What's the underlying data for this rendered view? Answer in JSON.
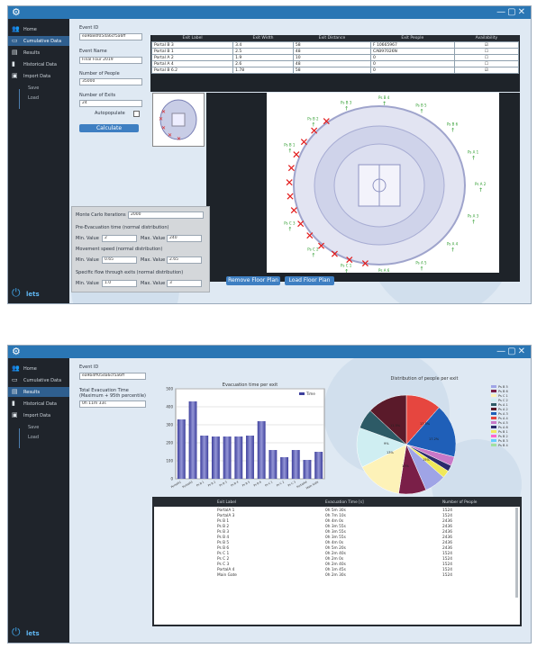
{
  "app": {
    "brand": "lets",
    "window_controls": "—▢✕"
  },
  "sidebar_top": [
    {
      "icon": "group-icon",
      "label": "Home",
      "glyph": "👥"
    },
    {
      "icon": "laptop-icon",
      "label": "Cumulative Data",
      "glyph": "▭",
      "active": true
    },
    {
      "icon": "doc-icon",
      "label": "Results",
      "glyph": "▤"
    },
    {
      "icon": "chart-icon",
      "label": "Historical Data",
      "glyph": "▮"
    },
    {
      "icon": "disk-icon",
      "label": "Import Data",
      "glyph": "▣"
    }
  ],
  "sidebar_top_sub": [
    "Save",
    "Load"
  ],
  "sidebar_bottom": [
    {
      "icon": "group-icon",
      "label": "Home",
      "glyph": "👥"
    },
    {
      "icon": "laptop-icon",
      "label": "Cumulative Data",
      "glyph": "▭"
    },
    {
      "icon": "doc-icon",
      "label": "Results",
      "glyph": "▤",
      "active": true
    },
    {
      "icon": "chart-icon",
      "label": "Historical Data",
      "glyph": "▮"
    },
    {
      "icon": "disk-icon",
      "label": "Import Data",
      "glyph": "▣"
    }
  ],
  "sidebar_bottom_sub": [
    "Save",
    "Load"
  ],
  "form": {
    "event_id_label": "Event ID",
    "event_id_value": "ea9b84f05da6cf5a6ff",
    "event_name_label": "Event Name",
    "event_name_value": "Final Four 2019",
    "people_label": "Number of People",
    "people_value": "35000",
    "exits_label": "Number of Exits",
    "exits_value": "24",
    "autopopulate_label": "Autopopulate",
    "calculate_label": "Calculate"
  },
  "exit_table": {
    "headers": [
      "Exit Label",
      "Exit Width",
      "Exit Distance",
      "Exit People",
      "Availability"
    ],
    "rows": [
      [
        "Portal B 3",
        "3.4",
        "58",
        "F 10665967",
        "☑"
      ],
      [
        "Portal B 1",
        "2.5",
        "48",
        "CAB97026N",
        "☐"
      ],
      [
        "Portal A 2",
        "1.9",
        "10",
        "0",
        "☐"
      ],
      [
        "Portal A 4",
        "2.6",
        "48",
        "0",
        "☐"
      ],
      [
        "Portal B 6.2",
        "1.78",
        "58",
        "0",
        "☑"
      ]
    ]
  },
  "params": {
    "iterations_label": "Monte Carlo Iterations",
    "iterations_value": "2000",
    "prep_label": "Pre-Evacuation time (normal distribution)",
    "prep_min_label": "Min. Value",
    "prep_min_value": "2",
    "prep_max_label": "Max. Value",
    "prep_max_value": "240",
    "speed_label": "Movement speed (normal distribution)",
    "speed_min_label": "Min. Value",
    "speed_min_value": "0.65",
    "speed_max_label": "Max. Value",
    "speed_max_value": "2.65",
    "flow_label": "Specific flow through exits (normal distribution)",
    "flow_min_label": "Min. Value",
    "flow_min_value": "1.0",
    "flow_max_label": "Max. Value",
    "flow_max_value": "3"
  },
  "buttons": {
    "remove_floor_plan": "Remove Floor Plan",
    "load_floor_plan": "Load Floor Plan"
  },
  "floor_plan_exit_labels": [
    "Ps B 1",
    "Ps B 2",
    "Ps B 3",
    "Ps B 4",
    "Ps B 5",
    "Ps B 6",
    "Ps A 1",
    "Ps A 2",
    "Ps A 3",
    "Ps A 4",
    "Ps A 5",
    "Ps A 6",
    "Ps C 1",
    "Ps C 2",
    "Ps C 3"
  ],
  "results": {
    "event_id_label": "Event ID",
    "event_id_value": "ea9b4ff05da6cf5a6ff",
    "total_time_label": "Total Evacuation Time",
    "total_time_sub": "(Maximum + 95th percentile)",
    "total_time_value": "0h 11m 33s"
  },
  "chart_data": [
    {
      "type": "bar",
      "title": "Evacuation time per exit",
      "legend": [
        "Time"
      ],
      "categories": [
        "PortalA1",
        "PortalA3",
        "Ps B 1",
        "Ps B 2",
        "Ps B 3",
        "Ps B 4",
        "Ps B 5",
        "Ps B 6",
        "Ps C 1",
        "Ps C 2",
        "Ps C 3",
        "PortalA4",
        "Main Gate"
      ],
      "values": [
        330,
        430,
        240,
        235,
        235,
        235,
        240,
        320,
        160,
        120,
        160,
        105,
        150
      ],
      "ylim": [
        0,
        500
      ],
      "yticks": [
        "0",
        "100",
        "200",
        "300",
        "400",
        "500"
      ],
      "colors": {
        "bar": "#3d3f9c",
        "bar_light": "#9496d6"
      }
    },
    {
      "type": "pie",
      "title": "Distribution of people per exit",
      "slices": [
        {
          "label": "PortalB 3",
          "value": 11.5,
          "color": "#e6463f"
        },
        {
          "label": "PortalB 1",
          "value": 17.5,
          "color": "#1f5fb8"
        },
        {
          "label": "Ps B 2",
          "value": 3.0,
          "color": "#c878c8"
        },
        {
          "label": "Ps B 1",
          "value": 2.0,
          "color": "#2b2b6c"
        },
        {
          "label": "Ps B 3",
          "value": 2.5,
          "color": "#f0e85a"
        },
        {
          "label": "Ps B 4",
          "value": 7.0,
          "color": "#9fa4e6"
        },
        {
          "label": "Ps B 5",
          "value": 9.0,
          "color": "#7a1f48"
        },
        {
          "label": "Ps B 6",
          "value": 15.0,
          "color": "#fdf2b8"
        },
        {
          "label": "Ps C 1",
          "value": 13.0,
          "color": "#cfeef2"
        },
        {
          "label": "Ps C 2",
          "value": 6.5,
          "color": "#2d5a66"
        },
        {
          "label": "PortalA 1",
          "value": 13.0,
          "color": "#5a1a2a"
        }
      ],
      "slice_labels": [
        "11.5%",
        "17.5%",
        "17.2%",
        "15%",
        "13%",
        "13%",
        "9%"
      ],
      "legend_items": [
        "Ps B 5",
        "Ps B 6",
        "Ps C 1",
        "Ps C 2",
        "Ps A 1",
        "Ps A 2",
        "Ps A 3",
        "Ps A 4",
        "Ps A 5",
        "Ps A 6",
        "Ps B 1",
        "Ps B 2",
        "Ps B 3",
        "Ps B 4"
      ],
      "legend_colors": [
        "#9fa4e6",
        "#7a1f48",
        "#fdf2b8",
        "#cfeef2",
        "#2d5a66",
        "#5a1a2a",
        "#1f5fb8",
        "#e6463f",
        "#c878c8",
        "#2b2b6c",
        "#f0e85a",
        "#ff66cc",
        "#66ccff",
        "#a0e0a0"
      ]
    }
  ],
  "results_table": {
    "headers": [
      "Exit Label",
      "Evacuation Time [s]",
      "Number of People"
    ],
    "rows": [
      [
        "PortalA 1",
        "0h 5m 30s",
        "1524"
      ],
      [
        "PortalA 3",
        "0h 7m 10s",
        "1524"
      ],
      [
        "Ps B 1",
        "0h 4m 0s",
        "2436"
      ],
      [
        "Ps B 2",
        "0h 3m 55s",
        "2436"
      ],
      [
        "Ps B 3",
        "0h 3m 55s",
        "2436"
      ],
      [
        "Ps B 4",
        "0h 3m 55s",
        "2436"
      ],
      [
        "Ps B 5",
        "0h 4m 0s",
        "2436"
      ],
      [
        "Ps B 6",
        "0h 5m 20s",
        "2436"
      ],
      [
        "Ps C 1",
        "0h 2m 40s",
        "1524"
      ],
      [
        "Ps C 2",
        "0h 2m 0s",
        "1524"
      ],
      [
        "Ps C 3",
        "0h 2m 40s",
        "1524"
      ],
      [
        "PortalA 4",
        "0h 1m 45s",
        "1524"
      ],
      [
        "Main Gate",
        "0h 2m 30s",
        "1524"
      ]
    ]
  }
}
